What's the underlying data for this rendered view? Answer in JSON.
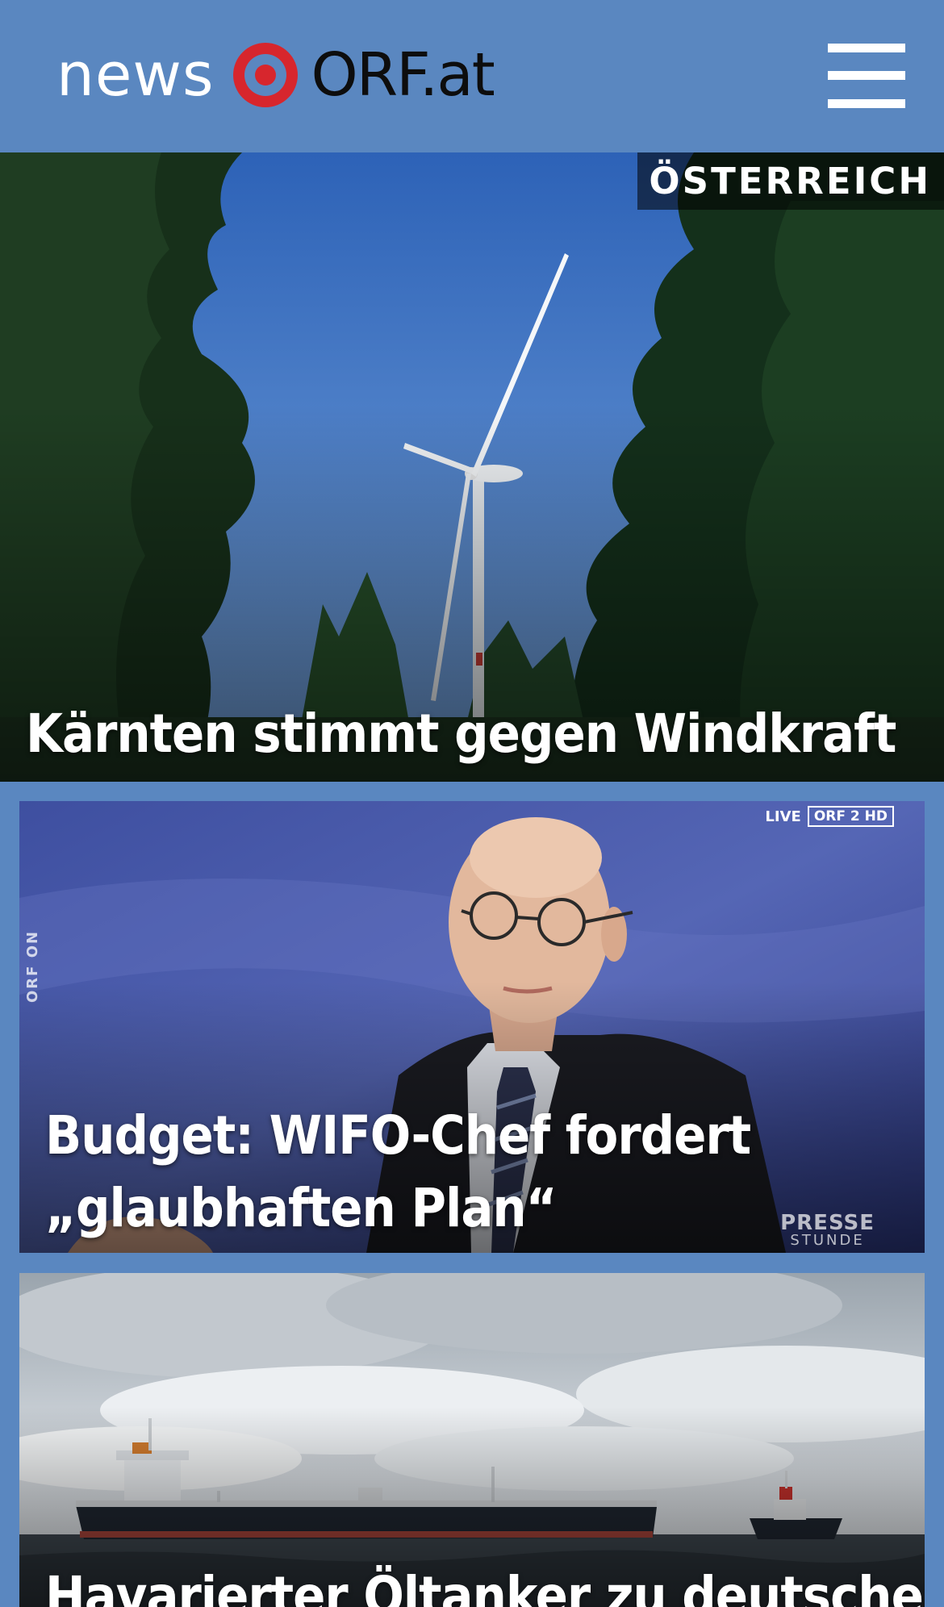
{
  "header": {
    "logo_news": "news",
    "logo_orf": "ORF.at",
    "menu_icon": "hamburger-menu-icon"
  },
  "stories": [
    {
      "category": "ÖSTERREICH",
      "title": "Kärnten stimmt gegen Windkraft",
      "image": "wind-turbine-forest-image"
    },
    {
      "title": "Budget: WIFO-Chef fordert „glaubhaften Plan“",
      "image": "tv-interview-image",
      "badge_live": "LIVE",
      "badge_channel": "ORF 2 HD",
      "watermark_side": "ORF ON",
      "watermark_show_1": "PRESSE",
      "watermark_show_2": "STUNDE"
    },
    {
      "title": "Havarierter Öltanker zu deutschem",
      "image": "oil-tanker-sea-image"
    }
  ],
  "colors": {
    "brand_blue": "#5a87c0",
    "logo_red": "#d7262d",
    "text_white": "#ffffff"
  }
}
